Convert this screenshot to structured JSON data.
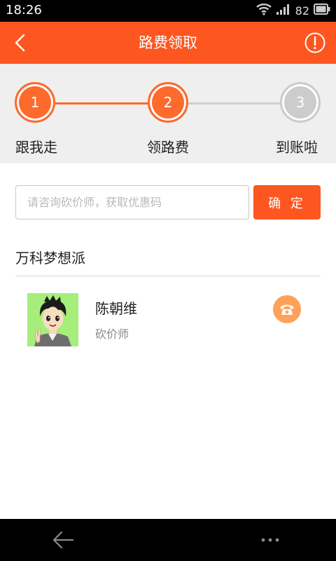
{
  "status_bar": {
    "time": "18:26",
    "battery_percent": "82",
    "icons": [
      "wifi-icon",
      "signal-icon",
      "battery-icon"
    ]
  },
  "header": {
    "title": "路费领取",
    "back_icon": "chevron-left-icon",
    "info_icon": "exclamation-circle-icon"
  },
  "steps": [
    {
      "number": "1",
      "label": "跟我走",
      "state": "done"
    },
    {
      "number": "2",
      "label": "领路费",
      "state": "active"
    },
    {
      "number": "3",
      "label": "到账啦",
      "state": "pending"
    }
  ],
  "coupon": {
    "placeholder": "请咨询砍价师，获取优惠码",
    "value": "",
    "confirm_label": "确 定"
  },
  "section": {
    "title": "万科梦想派"
  },
  "person": {
    "name": "陈朝维",
    "role": "砍价师",
    "call_icon": "phone-icon"
  },
  "colors": {
    "accent": "#fd5621",
    "step_done": "#fd6a2c",
    "step_pending": "#cccccc",
    "call_button": "#fea159",
    "avatar_bg": "#a6ee7c"
  },
  "nav_bar": {
    "icons": [
      "back-arrow-icon",
      "more-dots-icon"
    ]
  }
}
